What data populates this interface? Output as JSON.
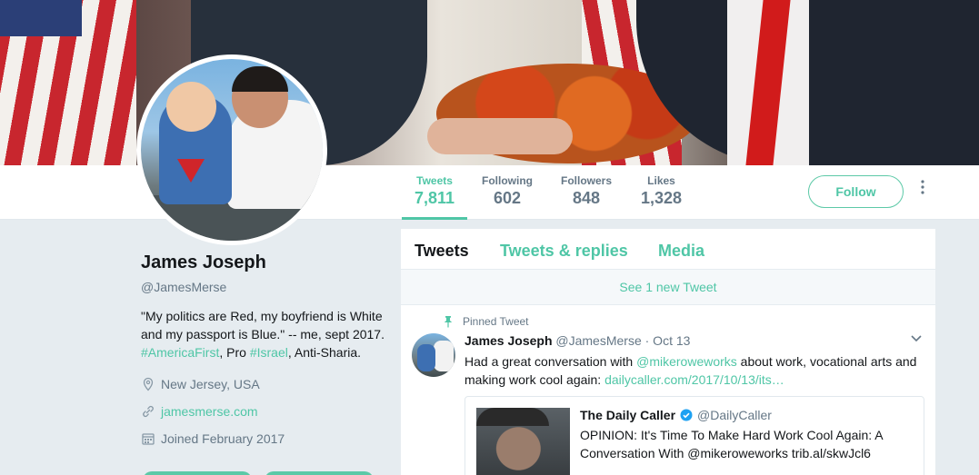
{
  "profile": {
    "name": "James Joseph",
    "handle": "@JamesMerse",
    "bio_text_1": "\"My politics are Red, my boyfriend is White and my passport is Blue.\" -- me, sept 2017. ",
    "bio_hashtag_1": "#AmericaFirst",
    "bio_text_2": ", Pro ",
    "bio_hashtag_2": "#Israel",
    "bio_text_3": ", Anti-Sharia.",
    "location": "New Jersey, USA",
    "website": "jamesmerse.com",
    "joined": "Joined February 2017"
  },
  "stats": [
    {
      "label": "Tweets",
      "value": "7,811"
    },
    {
      "label": "Following",
      "value": "602"
    },
    {
      "label": "Followers",
      "value": "848"
    },
    {
      "label": "Likes",
      "value": "1,328"
    }
  ],
  "actions": {
    "follow_label": "Follow"
  },
  "timeline": {
    "tabs": [
      "Tweets",
      "Tweets & replies",
      "Media"
    ],
    "new_tweets_label": "See 1 new Tweet"
  },
  "tweet": {
    "pinned_label": "Pinned Tweet",
    "author_name": "James Joseph",
    "author_handle": "@JamesMerse",
    "date": " · Oct 13",
    "text_1": "Had a great conversation with ",
    "mention": "@mikeroweworks",
    "text_2": " about work, vocational arts and making work cool again: ",
    "link": "dailycaller.com/2017/10/13/its…",
    "card": {
      "name": "The Daily Caller",
      "handle": "@DailyCaller",
      "text": "OPINION: It's Time To Make Hard Work Cool Again: A Conversation With @mikeroweworks trib.al/skwJcl6"
    }
  },
  "colors": {
    "accent": "#4fc6a6",
    "muted": "#657786",
    "text": "#14171a",
    "background": "#e6ecf0"
  }
}
